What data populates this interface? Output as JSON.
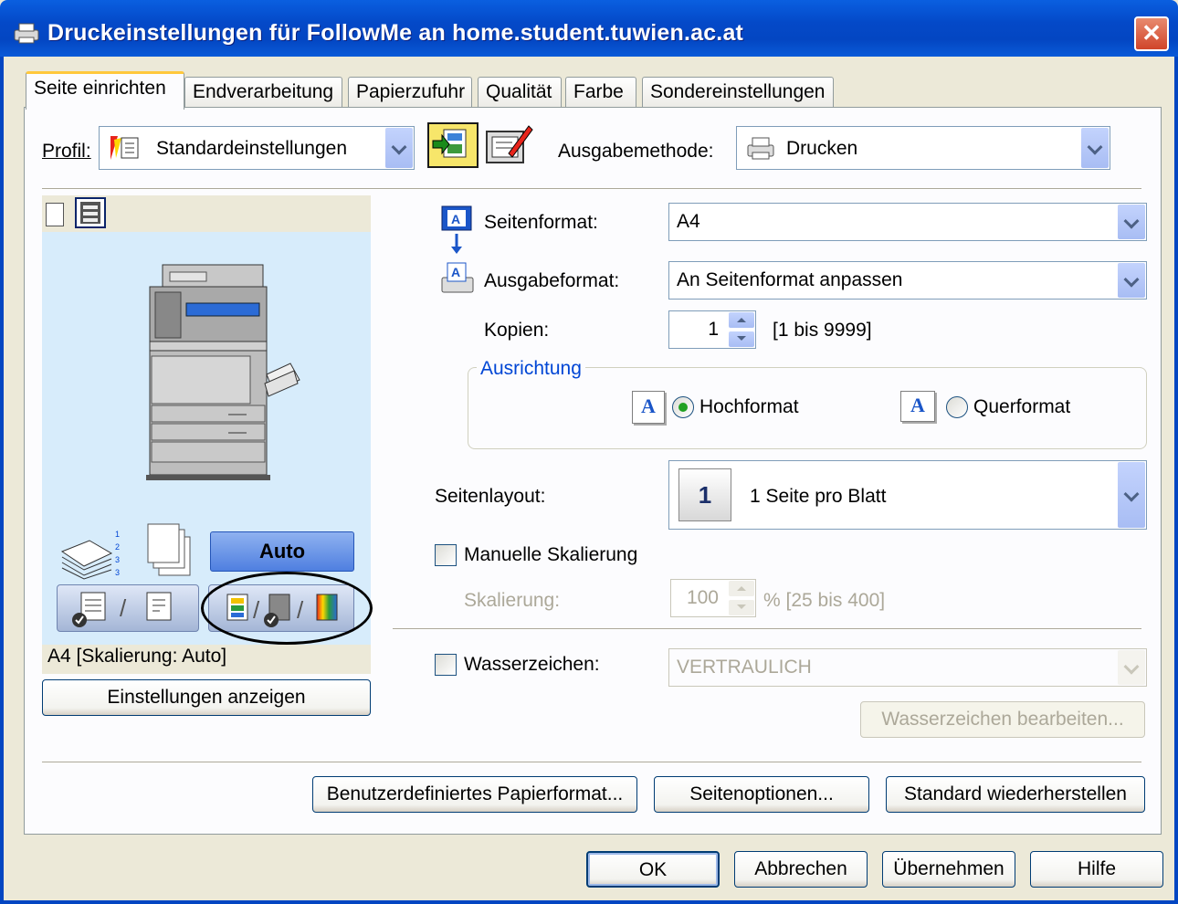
{
  "window": {
    "title": "Druckeinstellungen für FollowMe an home.student.tuwien.ac.at",
    "close_symbol": "✕"
  },
  "tabs": [
    {
      "label": "Seite einrichten",
      "active": true
    },
    {
      "label": "Endverarbeitung"
    },
    {
      "label": "Papierzufuhr"
    },
    {
      "label": "Qualität"
    },
    {
      "label": "Farbe"
    },
    {
      "label": "Sondereinstellungen"
    }
  ],
  "profile": {
    "label": "Profil:",
    "value": "Standardeinstellungen"
  },
  "output_method": {
    "label": "Ausgabemethode:",
    "value": "Drucken"
  },
  "preview": {
    "auto_label": "Auto",
    "status": "A4 [Skalierung: Auto]",
    "show_settings_button": "Einstellungen anzeigen"
  },
  "page_size": {
    "label": "Seitenformat:",
    "value": "A4"
  },
  "output_size": {
    "label": "Ausgabeformat:",
    "value": "An Seitenformat anpassen"
  },
  "copies": {
    "label": "Kopien:",
    "value": "1",
    "range": "[1 bis 9999]"
  },
  "orientation": {
    "group_label": "Ausrichtung",
    "portrait": "Hochformat",
    "landscape": "Querformat",
    "icon_letter": "A"
  },
  "page_layout": {
    "label": "Seitenlayout:",
    "number": "1",
    "value": "1 Seite pro Blatt"
  },
  "manual_scaling": {
    "label": "Manuelle Skalierung",
    "checked": false
  },
  "scaling": {
    "label": "Skalierung:",
    "value": "100",
    "range": "% [25 bis 400]"
  },
  "watermark": {
    "label": "Wasserzeichen:",
    "checked": false,
    "value": "VERTRAULICH",
    "edit_button": "Wasserzeichen bearbeiten..."
  },
  "bottom_buttons": {
    "custom_paper": "Benutzerdefiniertes Papierformat...",
    "page_options": "Seitenoptionen...",
    "restore_defaults": "Standard wiederherstellen"
  },
  "dialog_buttons": {
    "ok": "OK",
    "cancel": "Abbrechen",
    "apply": "Übernehmen",
    "help": "Hilfe"
  },
  "colors": {
    "titlebar": "#0346c2",
    "dialog_bg": "#ece9d8",
    "panel_bg": "#fcfcfe",
    "preview_bg": "#d7ecfb",
    "accent_blue": "#0046d5",
    "tab_highlight": "#ffc83c"
  }
}
